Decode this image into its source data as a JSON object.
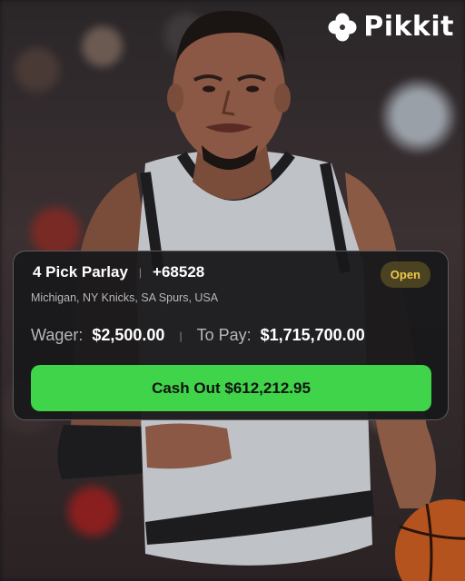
{
  "brand": {
    "name": "Pikkit"
  },
  "bet": {
    "title": "4 Pick Parlay",
    "odds": "+68528",
    "status": "Open",
    "legs": "Michigan, NY Knicks, SA Spurs, USA",
    "wager_label": "Wager:",
    "wager_value": "$2,500.00",
    "payout_label": "To Pay:",
    "payout_value": "$1,715,700.00",
    "cashout_label": "Cash Out $612,212.95"
  },
  "colors": {
    "accent_green": "#3fd44a",
    "status_badge": "#4a4220",
    "status_text": "#f0c84a"
  },
  "icons": [
    "clover-logo-icon"
  ]
}
